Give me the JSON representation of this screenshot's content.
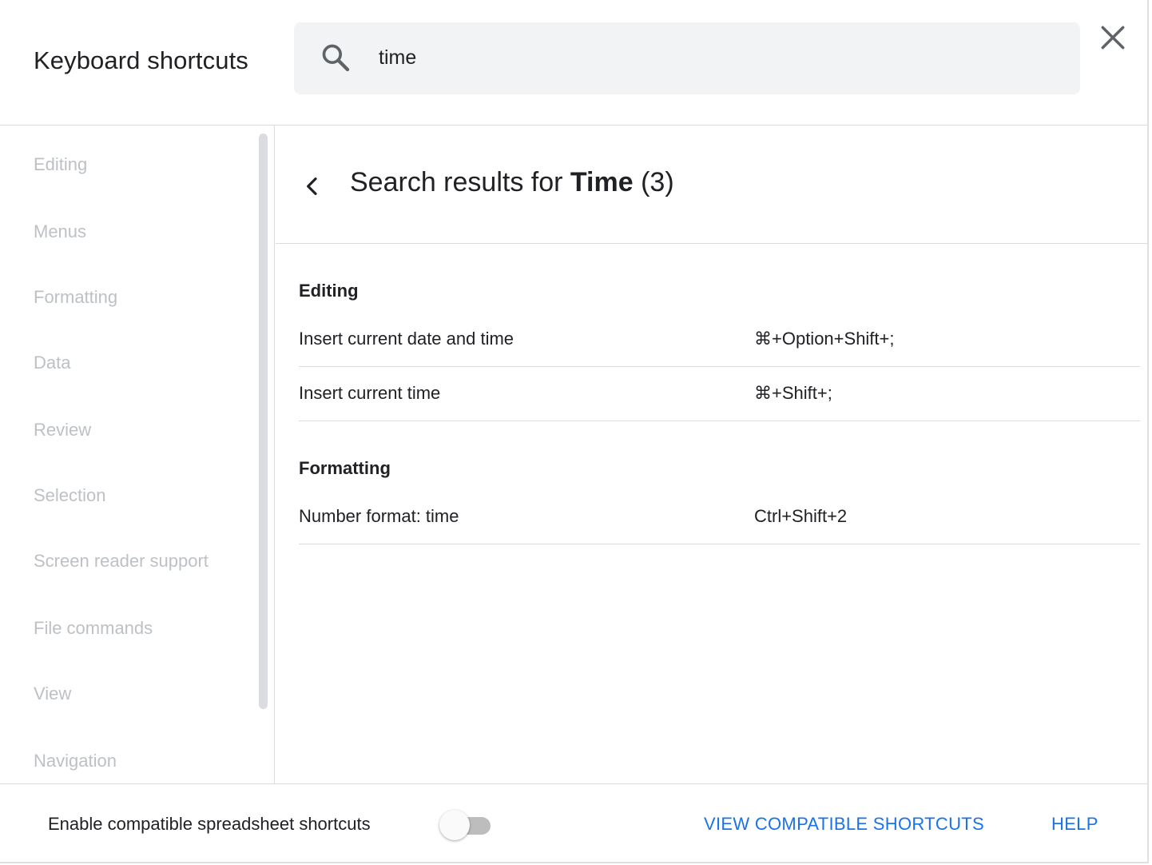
{
  "dialog": {
    "title": "Keyboard shortcuts",
    "close_icon": "close-icon"
  },
  "search": {
    "value": "time",
    "icon": "search-icon"
  },
  "sidebar": {
    "items": [
      {
        "label": "Editing"
      },
      {
        "label": "Menus"
      },
      {
        "label": "Formatting"
      },
      {
        "label": "Data"
      },
      {
        "label": "Review"
      },
      {
        "label": "Selection"
      },
      {
        "label": "Screen reader support"
      },
      {
        "label": "File commands"
      },
      {
        "label": "View"
      },
      {
        "label": "Navigation"
      }
    ]
  },
  "results": {
    "prefix": "Search results for ",
    "query": "Time",
    "count": "(3)",
    "sections": [
      {
        "title": "Editing",
        "rows": [
          {
            "desc": "Insert current date and time",
            "keys": "⌘+Option+Shift+;"
          },
          {
            "desc": "Insert current time",
            "keys": "⌘+Shift+;"
          }
        ]
      },
      {
        "title": "Formatting",
        "rows": [
          {
            "desc": "Number format: time",
            "keys": "Ctrl+Shift+2"
          }
        ]
      }
    ]
  },
  "footer": {
    "compat_label": "Enable compatible spreadsheet shortcuts",
    "compat_enabled": false,
    "view_compat_link": "VIEW COMPATIBLE SHORTCUTS",
    "help_link": "HELP"
  },
  "colors": {
    "accent": "#1a73e8",
    "muted_text": "#bdc1c6",
    "search_bg": "#f1f3f4"
  }
}
